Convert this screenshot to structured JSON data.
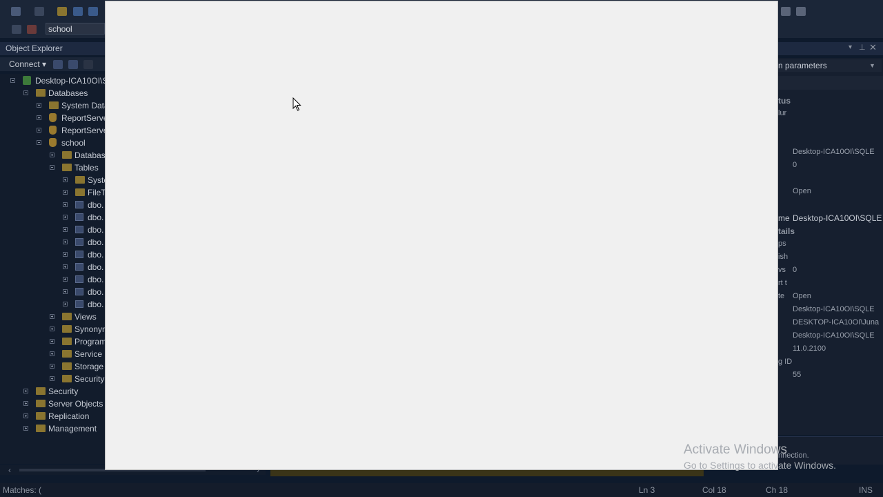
{
  "toolbar": {
    "database_selector_value": "school"
  },
  "object_explorer": {
    "title": "Object Explorer",
    "connect_label": "Connect ▾",
    "tree": [
      {
        "label": "Desktop-ICA10OI\\S",
        "level": 0,
        "kind": "server",
        "expander": "minus"
      },
      {
        "label": "Databases",
        "level": 1,
        "kind": "folder",
        "expander": "minus"
      },
      {
        "label": "System Data",
        "level": 2,
        "kind": "folder",
        "expander": "plus"
      },
      {
        "label": "ReportServe",
        "level": 2,
        "kind": "db",
        "expander": "plus"
      },
      {
        "label": "ReportServe",
        "level": 2,
        "kind": "db",
        "expander": "plus"
      },
      {
        "label": "school",
        "level": 2,
        "kind": "db",
        "expander": "minus"
      },
      {
        "label": "Databas",
        "level": 3,
        "kind": "folder",
        "expander": "plus"
      },
      {
        "label": "Tables",
        "level": 3,
        "kind": "folder",
        "expander": "minus"
      },
      {
        "label": "Syste",
        "level": 4,
        "kind": "folder",
        "expander": "plus"
      },
      {
        "label": "FileT",
        "level": 4,
        "kind": "folder",
        "expander": "plus"
      },
      {
        "label": "dbo.",
        "level": 4,
        "kind": "table",
        "expander": "plus"
      },
      {
        "label": "dbo.",
        "level": 4,
        "kind": "table",
        "expander": "plus"
      },
      {
        "label": "dbo.",
        "level": 4,
        "kind": "table",
        "expander": "plus"
      },
      {
        "label": "dbo.",
        "level": 4,
        "kind": "table",
        "expander": "plus"
      },
      {
        "label": "dbo.",
        "level": 4,
        "kind": "table",
        "expander": "plus"
      },
      {
        "label": "dbo.",
        "level": 4,
        "kind": "table",
        "expander": "plus"
      },
      {
        "label": "dbo.",
        "level": 4,
        "kind": "table",
        "expander": "plus"
      },
      {
        "label": "dbo.",
        "level": 4,
        "kind": "table",
        "expander": "plus"
      },
      {
        "label": "dbo.",
        "level": 4,
        "kind": "table",
        "expander": "plus"
      },
      {
        "label": "Views",
        "level": 3,
        "kind": "folder",
        "expander": "plus"
      },
      {
        "label": "Synonyn",
        "level": 3,
        "kind": "folder",
        "expander": "plus"
      },
      {
        "label": "Program",
        "level": 3,
        "kind": "folder",
        "expander": "plus"
      },
      {
        "label": "Service E",
        "level": 3,
        "kind": "folder",
        "expander": "plus"
      },
      {
        "label": "Storage",
        "level": 3,
        "kind": "folder",
        "expander": "plus"
      },
      {
        "label": "Security",
        "level": 3,
        "kind": "folder",
        "expander": "plus"
      },
      {
        "label": "Security",
        "level": 1,
        "kind": "folder",
        "expander": "plus"
      },
      {
        "label": "Server Objects",
        "level": 1,
        "kind": "folder",
        "expander": "plus"
      },
      {
        "label": "Replication",
        "level": 1,
        "kind": "folder",
        "expander": "plus"
      },
      {
        "label": "Management",
        "level": 1,
        "kind": "folder",
        "expander": "plus"
      }
    ]
  },
  "properties_panel": {
    "selector_value": "n parameters",
    "rows": [
      {
        "label": "tus",
        "value": "",
        "style": "hdr"
      },
      {
        "label": "lur",
        "value": "",
        "style": ""
      },
      {
        "label": "",
        "value": "Desktop-ICA10OI\\SQLE",
        "style": ""
      },
      {
        "label": "",
        "value": "0",
        "style": ""
      },
      {
        "label": "",
        "value": "Open",
        "style": ""
      },
      {
        "label": "me",
        "value": "Desktop-ICA10OI\\SQLE",
        "style": "strong"
      },
      {
        "label": "tails",
        "value": "",
        "style": "hdr"
      },
      {
        "label": "ps",
        "value": "",
        "style": ""
      },
      {
        "label": "ish",
        "value": "",
        "style": ""
      },
      {
        "label": "vs",
        "value": "0",
        "style": ""
      },
      {
        "label": "rt t",
        "value": "",
        "style": ""
      },
      {
        "label": "te",
        "value": "Open",
        "style": ""
      },
      {
        "label": "",
        "value": "Desktop-ICA10OI\\SQLE",
        "style": ""
      },
      {
        "label": "",
        "value": "DESKTOP-ICA10OI\\Juna",
        "style": ""
      },
      {
        "label": "",
        "value": "Desktop-ICA10OI\\SQLE",
        "style": ""
      },
      {
        "label": "",
        "value": "11.0.2100",
        "style": ""
      },
      {
        "label": "g ID",
        "value": "",
        "style": ""
      },
      {
        "label": "",
        "value": "55",
        "style": ""
      }
    ],
    "bottom_text": "nnection."
  },
  "status": {
    "matches": "Matches: (",
    "ln": "Ln 3",
    "col": "Col 18",
    "ch": "Ch 18",
    "ins": "INS"
  },
  "watermark": {
    "line1": "Activate Windows",
    "line2": "Go to Settings to activate Windows."
  }
}
